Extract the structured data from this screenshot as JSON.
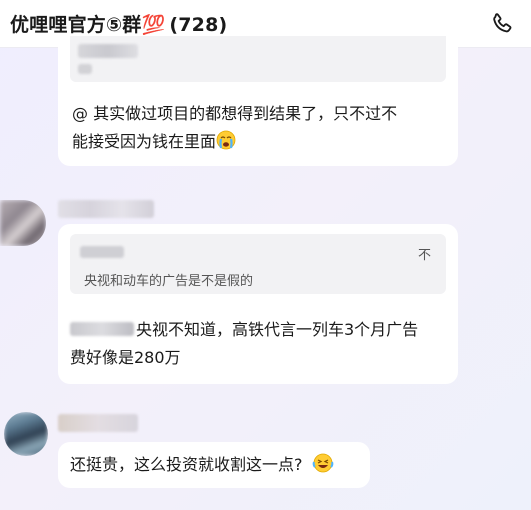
{
  "header": {
    "group_name": "优哩哩官方⑤群💯",
    "member_count": "(728)",
    "call_icon": "phone-icon"
  },
  "messages": [
    {
      "id": "m1",
      "line1": "@      其实做过项目的都想得到结果了，只不过不",
      "line2": "能接受因为钱在里面",
      "emoji": "crying-face"
    },
    {
      "id": "m2",
      "quote_suffix": "不",
      "quote_text": "央视和动车的广告是不是假的",
      "line1": "央视不知道，高铁代言一列车3个月广告",
      "line2": "费好像是280万"
    },
    {
      "id": "m3",
      "line1": "还挺贵，这么投资就收割这一点?",
      "emoji": "laughing-face"
    }
  ]
}
